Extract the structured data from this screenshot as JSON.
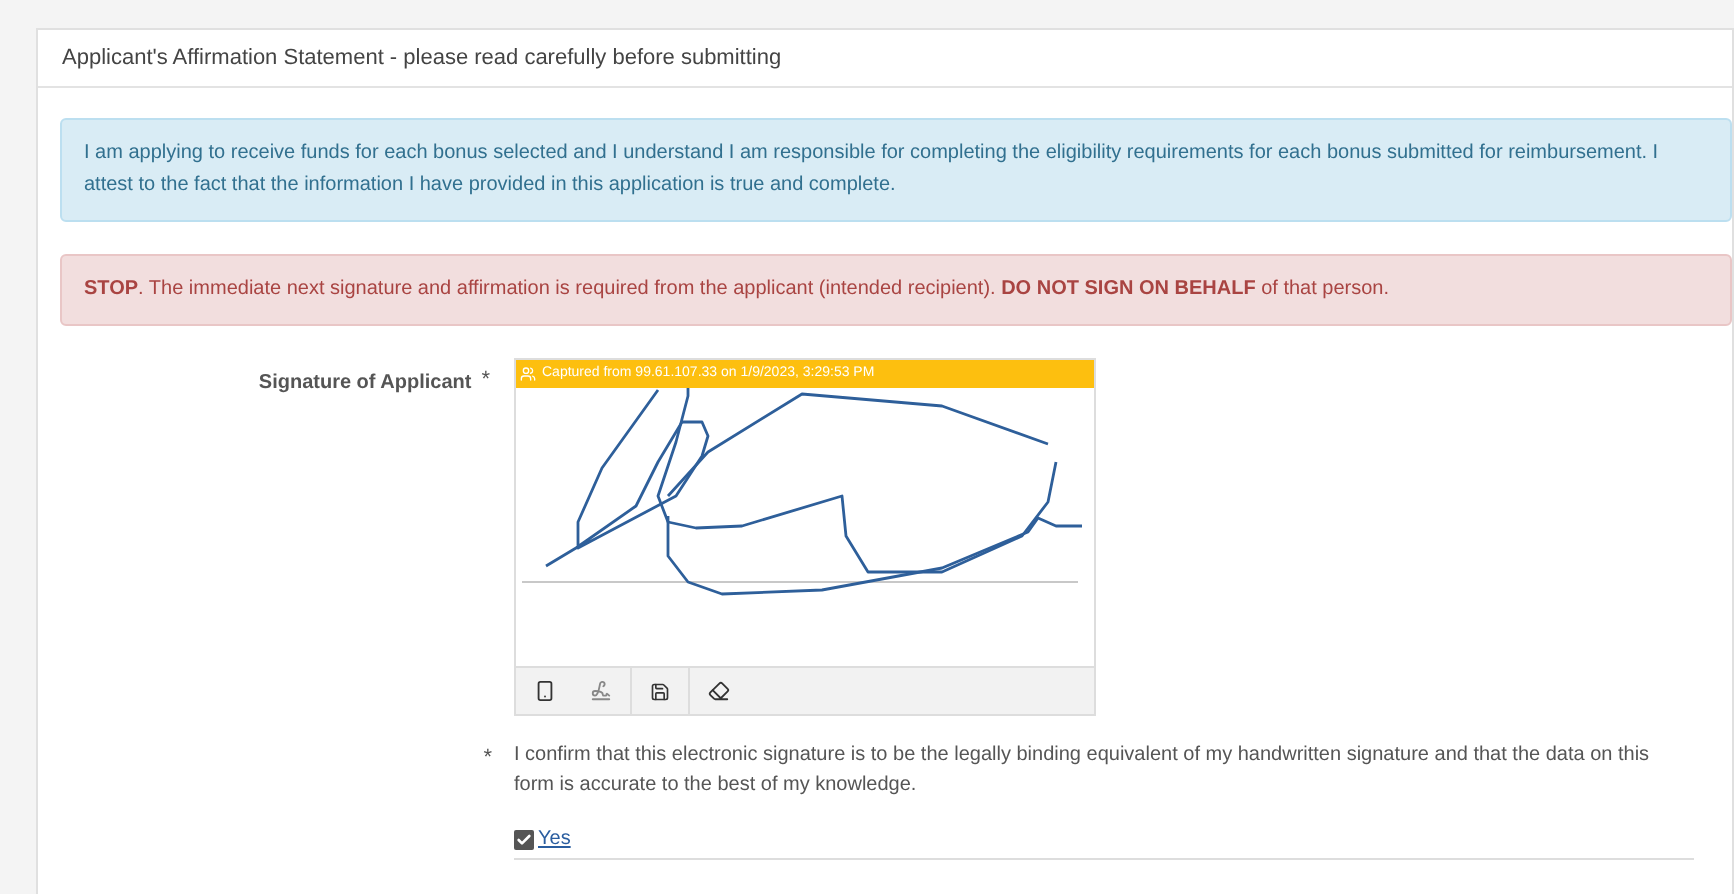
{
  "panel": {
    "title": "Applicant's Affirmation Statement - please read carefully before submitting"
  },
  "info_box": {
    "text": "I am applying to receive funds for each bonus selected and I understand I am responsible for completing the eligibility requirements for each bonus submitted for reimbursement. I attest to the fact that the information I have provided in this application is true and complete."
  },
  "warning_box": {
    "text": "**STOP**. The immediate next signature and affirmation is required from the applicant (intended recipient). **DO NOT SIGN ON BEHALF** of that person."
  },
  "signature": {
    "label": "Signature of Applicant",
    "required_mark": "*",
    "captured_banner": "Captured from 99.61.107.33 on 1/9/2023, 3:29:53 PM"
  },
  "confirmation": {
    "required_mark": "*",
    "text": "I confirm that this electronic signature is to be the legally binding equivalent of my handwritten signature and that the data on this form is accurate to the best of my knowledge.",
    "option": {
      "label": "Yes",
      "checked": true
    }
  }
}
